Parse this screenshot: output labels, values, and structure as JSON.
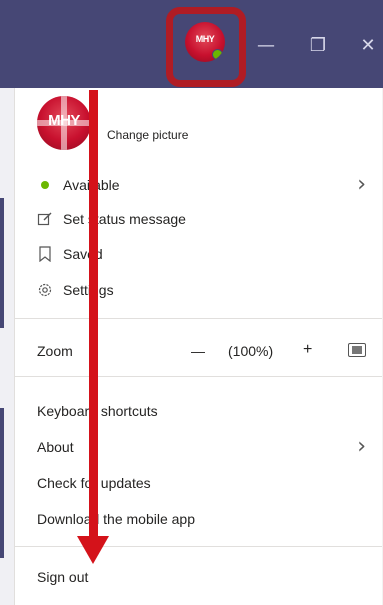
{
  "window": {
    "minimize_glyph": "—",
    "maximize_glyph": "❐",
    "close_glyph": "✕"
  },
  "profile": {
    "avatar_text": "MHY",
    "change_picture": "Change picture"
  },
  "menu_items": [
    {
      "label": "Available",
      "icon": "status-dot-icon",
      "has_chevron": true
    },
    {
      "label": "Set status message",
      "icon": "edit-icon"
    },
    {
      "label": "Saved",
      "icon": "bookmark-icon"
    },
    {
      "label": "Settings",
      "icon": "gear-icon"
    }
  ],
  "zoom": {
    "label": "Zoom",
    "minus": "—",
    "value": "(100%)",
    "plus": "+"
  },
  "lower_items": [
    {
      "label": "Keyboard shortcuts"
    },
    {
      "label": "About",
      "has_chevron": true
    },
    {
      "label": "Check for updates"
    },
    {
      "label": "Download the mobile app"
    }
  ],
  "sign_out": "Sign out",
  "colors": {
    "titlebar": "#464775",
    "status_available": "#6bb700",
    "annotation_red": "#d4121a",
    "callout_border": "#b01c24"
  }
}
